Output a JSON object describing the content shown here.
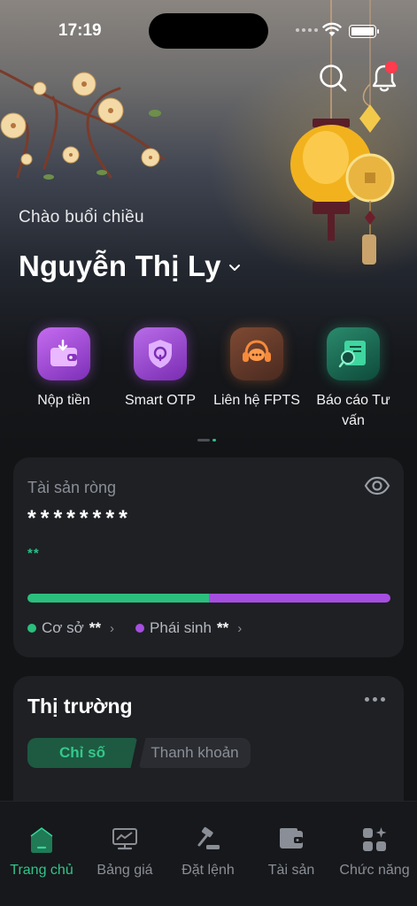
{
  "status_bar": {
    "time": "17:19"
  },
  "header": {
    "search_icon": "search-icon",
    "bell_icon": "bell-icon",
    "notification_dot_color": "#ff3b4e"
  },
  "greeting": "Chào buổi chiều",
  "user": {
    "name": "Nguyễn Thị Ly"
  },
  "quick_actions": [
    {
      "label": "Nộp tiền",
      "icon": "wallet-deposit-icon"
    },
    {
      "label": "Smart OTP",
      "icon": "shield-otp-icon"
    },
    {
      "label": "Liên hệ FPTS",
      "icon": "headset-support-icon"
    },
    {
      "label": "Báo cáo Tư vấn",
      "icon": "report-advice-icon"
    }
  ],
  "net_assets": {
    "title": "Tài sản ròng",
    "value_masked": "********",
    "change_masked": "**",
    "base_share": 0.5,
    "legend": [
      {
        "label": "Cơ sở",
        "value": "**",
        "color": "#2bbf7e"
      },
      {
        "label": "Phái sinh",
        "value": "**",
        "color": "#a64ee0"
      }
    ]
  },
  "market": {
    "title": "Thị trường",
    "tabs": [
      {
        "label": "Chỉ số",
        "active": true
      },
      {
        "label": "Thanh khoản",
        "active": false
      }
    ]
  },
  "bottom_nav": [
    {
      "label": "Trang chủ",
      "icon": "home-icon",
      "active": true
    },
    {
      "label": "Bảng giá",
      "icon": "price-board-icon",
      "active": false
    },
    {
      "label": "Đặt lệnh",
      "icon": "gavel-order-icon",
      "active": false
    },
    {
      "label": "Tài sản",
      "icon": "wallet-icon",
      "active": false
    },
    {
      "label": "Chức năng",
      "icon": "grid-functions-icon",
      "active": false
    }
  ],
  "colors": {
    "accent_green": "#2fc58b",
    "accent_purple": "#a64ee0",
    "background": "#131416"
  }
}
